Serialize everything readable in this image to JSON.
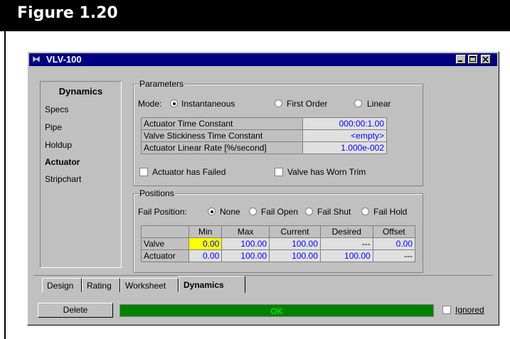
{
  "figure": {
    "title": "Figure 1.20"
  },
  "window": {
    "title": "VLV-100",
    "icon": "valve-icon"
  },
  "nav": {
    "header": "Dynamics",
    "items": [
      "Specs",
      "Pipe",
      "Holdup",
      "Actuator",
      "Stripchart"
    ],
    "active": "Actuator"
  },
  "parameters": {
    "label": "Parameters",
    "mode_label": "Mode:",
    "modes": [
      "Instantaneous",
      "First Order",
      "Linear"
    ],
    "selected_mode": "Instantaneous",
    "table": [
      {
        "name": "Actuator Time Constant",
        "value": "000:00:1.00"
      },
      {
        "name": "Valve Stickiness Time Constant",
        "value": "<empty>"
      },
      {
        "name": "Actuator Linear Rate [%/second]",
        "value": "1.000e-002"
      }
    ],
    "check1": "Actuator has Failed",
    "check2": "Valve has Worn Trim"
  },
  "positions": {
    "label": "Positions",
    "fail_label": "Fail Position:",
    "fail_options": [
      "None",
      "Fail Open",
      "Fail Shut",
      "Fail Hold"
    ],
    "selected_fail": "None",
    "headers": [
      "Min",
      "Max",
      "Current",
      "Desired",
      "Offset"
    ],
    "rows": [
      {
        "name": "Valve",
        "cells": [
          "0.00",
          "100.00",
          "100.00",
          "---",
          "0.00"
        ]
      },
      {
        "name": "Actuator",
        "cells": [
          "0.00",
          "100.00",
          "100.00",
          "100.00",
          "---"
        ]
      }
    ]
  },
  "tabs": [
    "Design",
    "Rating",
    "Worksheet",
    "Dynamics"
  ],
  "active_tab": "Dynamics",
  "footer": {
    "delete_label": "Delete",
    "status": "OK",
    "ignored_label": "Ignored"
  },
  "colors": {
    "title_bar": "#000080",
    "status_ok": "#008000",
    "value_blue": "#0000ff",
    "highlight": "#ffff00"
  }
}
